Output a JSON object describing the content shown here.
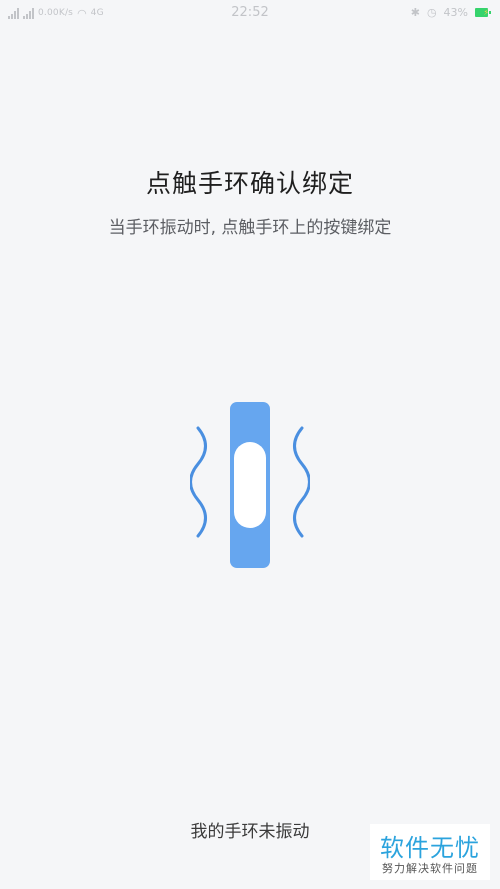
{
  "status_bar": {
    "speed": "0.00K/s",
    "network": "4G",
    "time": "22:52",
    "battery": "43%"
  },
  "page": {
    "title": "点触手环确认绑定",
    "subtitle": "当手环振动时, 点触手环上的按键绑定",
    "bottom_link": "我的手环未振动"
  },
  "illustration": {
    "icon": "vibrating-band",
    "color": "#66a6ef",
    "wave_color": "#4a8fe0"
  },
  "watermark": {
    "title": "软件无忧",
    "subtitle": "努力解决软件问题"
  }
}
